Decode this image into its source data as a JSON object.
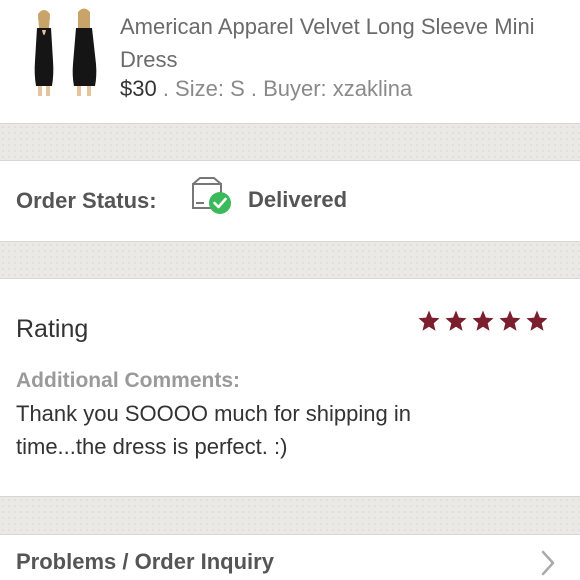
{
  "product": {
    "title": "American Apparel Velvet Long Sleeve Mini Dress",
    "price": "$30",
    "meta": " . Size: S . Buyer: xzaklina",
    "thumbnail_icon": "dress-photo"
  },
  "order_status": {
    "label": "Order Status:",
    "value": "Delivered",
    "icon": "delivered-box-icon",
    "check_color": "#3cb95a"
  },
  "rating": {
    "label": "Rating",
    "stars": 5,
    "max_stars": 5,
    "star_color": "#7b1e2e",
    "comments_label": "Additional Comments:",
    "comments_text": "Thank you SOOOO much for shipping in time...the dress is perfect. :)"
  },
  "problems": {
    "label": "Problems / Order Inquiry",
    "icon": "chevron-right-icon"
  }
}
